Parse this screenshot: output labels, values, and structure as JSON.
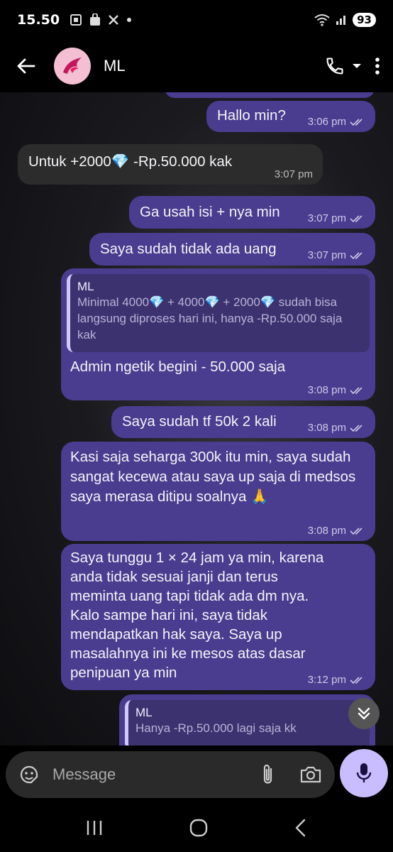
{
  "status_bar": {
    "time": "15.50",
    "battery": "93"
  },
  "header": {
    "contact_name": "ML"
  },
  "messages": [
    {
      "text": "Hallo min?",
      "time": "3:06 pm"
    },
    {
      "text": "Untuk +2000💎 -Rp.50.000 kak",
      "time": "3:07 pm"
    },
    {
      "text": "Ga usah isi + nya min",
      "time": "3:07 pm"
    },
    {
      "text": "Saya sudah tidak ada uang",
      "time": "3:07 pm"
    },
    {
      "quote_name": "ML",
      "quote_text": "Minimal 4000💎 + 4000💎 + 2000💎 sudah bisa langsung diproses hari ini, hanya -Rp.50.000 saja kak",
      "text": "Admin ngetik begini - 50.000 saja",
      "time": "3:08 pm"
    },
    {
      "text": "Saya sudah tf 50k 2 kali",
      "time": "3:08 pm"
    },
    {
      "text": "Kasi saja seharga 300k itu min, saya sudah sangat kecewa atau saya up saja di medsos saya merasa ditipu soalnya 🙏",
      "time": "3:08 pm"
    },
    {
      "text": "Saya tunggu 1 × 24 jam ya min, karena anda tidak sesuai janji dan terus meminta uang tapi tidak ada dm nya. Kalo sampe hari ini, saya tidak mendapatkan hak saya. Saya up masalahnya ini ke mesos atas dasar penipuan ya min",
      "time": "3:12 pm"
    },
    {
      "quote_name": "ML",
      "quote_text": "Hanya -Rp.50.000 lagi saja kk"
    }
  ],
  "composer": {
    "placeholder": "Message"
  }
}
